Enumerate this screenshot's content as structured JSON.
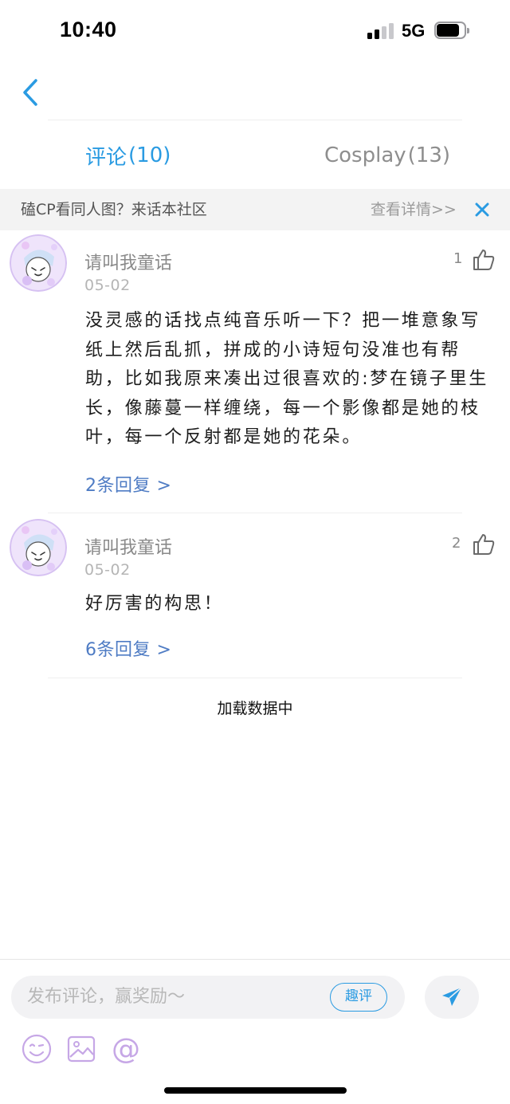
{
  "status_bar": {
    "time": "10:40",
    "network": "5G"
  },
  "tabs": [
    {
      "label": "评论",
      "count": "(10)",
      "active": true
    },
    {
      "label": "Cosplay",
      "count": "(13)",
      "active": false
    }
  ],
  "promo": {
    "text": "磕CP看同人图？来话本社区",
    "link": "查看详情>>"
  },
  "comments": [
    {
      "username": "请叫我童话",
      "date": "05-02",
      "likes": "1",
      "text": "没灵感的话找点纯音乐听一下？把一堆意象写纸上然后乱抓，拼成的小诗短句没准也有帮助，比如我原来凑出过很喜欢的:梦在镜子里生长，像藤蔓一样缠绕，每一个影像都是她的枝叶，每一个反射都是她的花朵。",
      "replies": "2条回复 >"
    },
    {
      "username": "请叫我童话",
      "date": "05-02",
      "likes": "2",
      "text": "好厉害的构思！",
      "replies": "6条回复 >"
    }
  ],
  "loading_text": "加载数据中",
  "bottom_bar": {
    "placeholder": "发布评论，赢奖励～",
    "quping_label": "趣评",
    "tools": [
      "emoji-icon",
      "image-icon",
      "at-icon"
    ],
    "tool_mention_glyph": "@"
  },
  "colors": {
    "accent": "#2a9be2",
    "reply_link": "#4f7cc4",
    "tool_purple": "#c6a7e6",
    "promo_bg": "#f3f3f3"
  }
}
